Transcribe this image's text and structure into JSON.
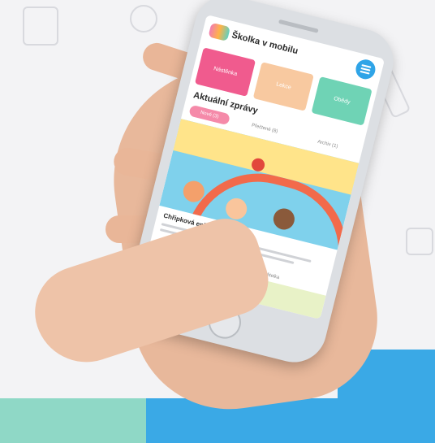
{
  "app": {
    "title": "Školka v mobilu"
  },
  "tiles": [
    {
      "label": "Nástěnka",
      "color": "#f05b8e"
    },
    {
      "label": "Lekce",
      "color": "#f8c9a0"
    },
    {
      "label": "Obědy",
      "color": "#6fd3b5"
    }
  ],
  "news": {
    "section_title": "Aktuální zprávy",
    "filters": [
      "Nové (3)",
      "Přečtené (8)",
      "Archiv (1)"
    ],
    "card_title": "Chřipková epidemie",
    "author": "Ředitelka"
  },
  "colors": {
    "accent_blue": "#3aa9e6",
    "accent_green": "#8fd8c6",
    "accent_pink": "#f05b8e"
  }
}
